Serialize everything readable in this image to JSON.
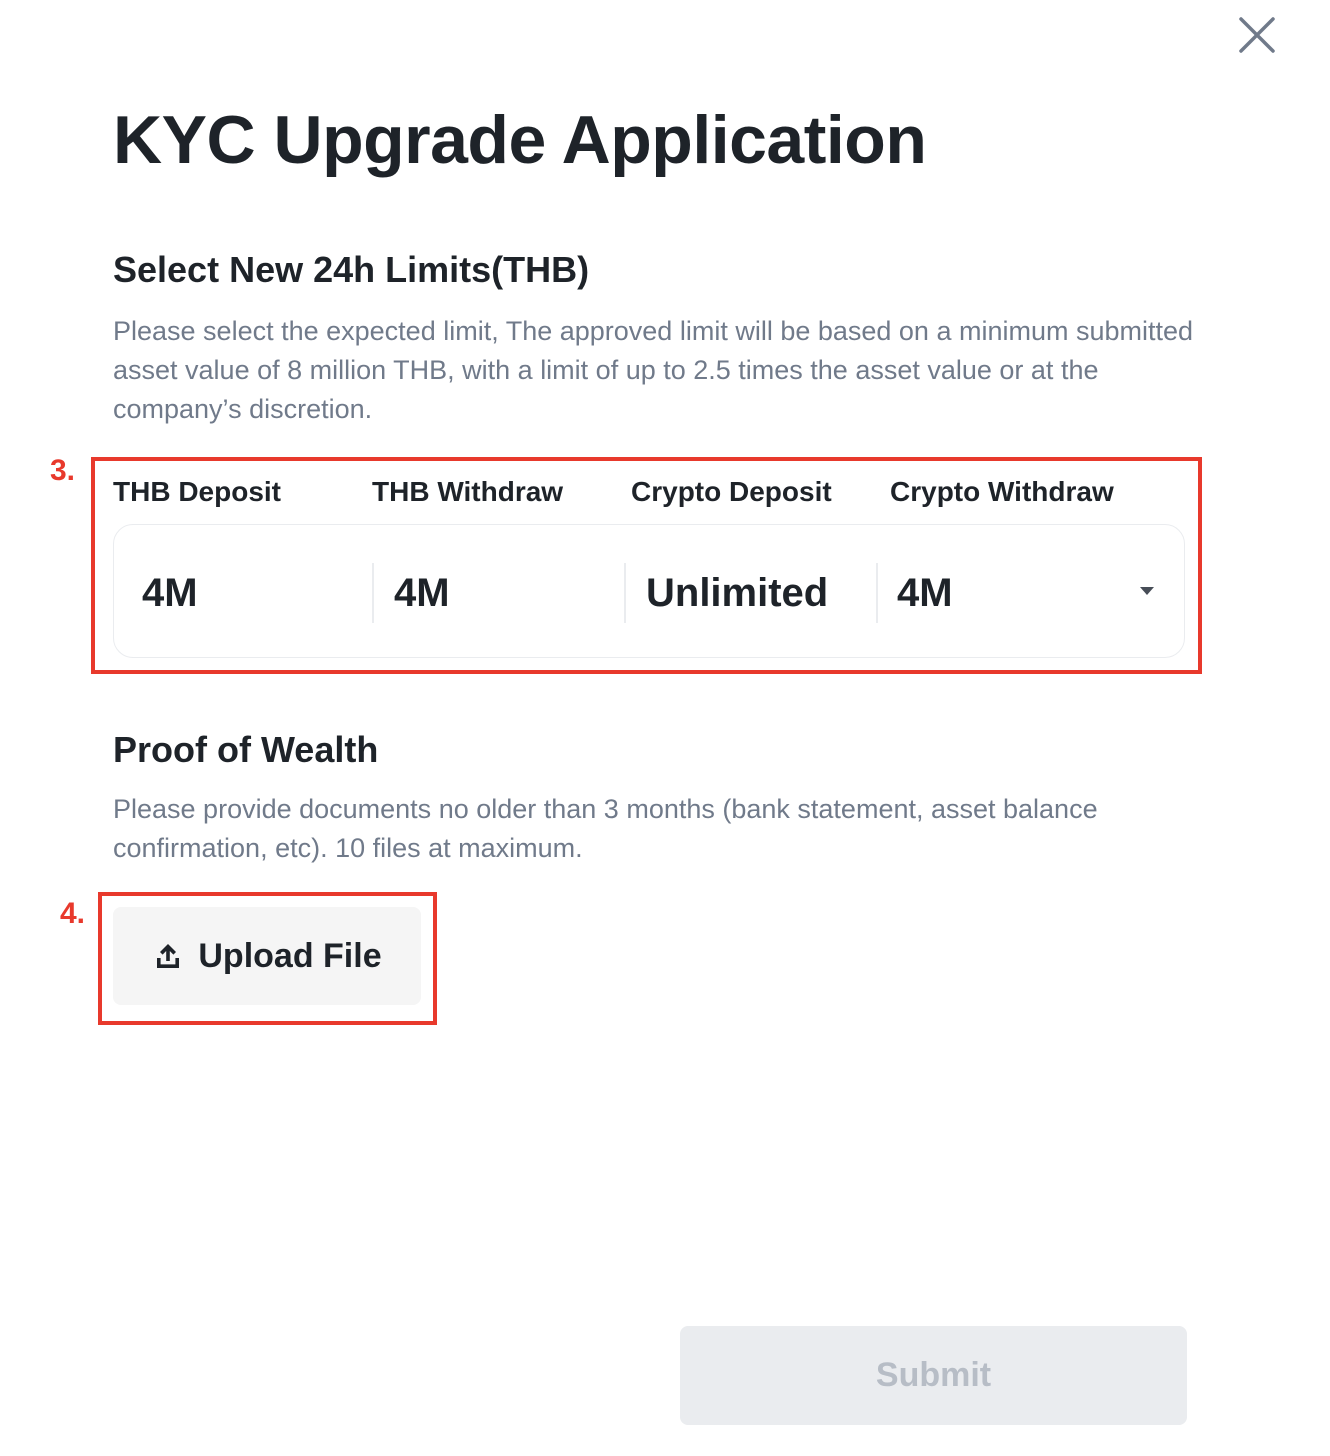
{
  "dialog": {
    "title": "KYC Upgrade Application",
    "close_icon": "close-icon"
  },
  "limits": {
    "heading": "Select New 24h Limits(THB)",
    "description": "Please select the expected limit, The approved limit will be based on a minimum submitted asset value of 8 million THB, with a limit of up to 2.5 times the asset value or at the company’s discretion.",
    "columns": [
      {
        "label": "THB Deposit",
        "value": "4M"
      },
      {
        "label": "THB Withdraw",
        "value": "4M"
      },
      {
        "label": "Crypto Deposit",
        "value": "Unlimited"
      },
      {
        "label": "Crypto Withdraw",
        "value": "4M"
      }
    ],
    "dropdown_icon": "caret-down-icon"
  },
  "wealth": {
    "heading": "Proof of Wealth",
    "description": "Please provide documents no older than 3 months (bank statement, asset balance confirmation, etc). 10 files at maximum.",
    "upload_label": "Upload File",
    "upload_icon": "upload-icon"
  },
  "annotations": {
    "step3": "3.",
    "step4": "4.",
    "color": "#e8392c"
  },
  "footer": {
    "submit_label": "Submit"
  }
}
